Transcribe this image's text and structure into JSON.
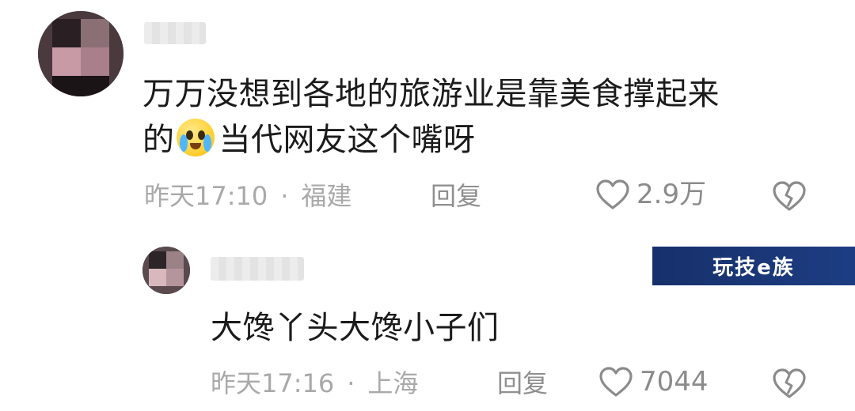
{
  "comments": [
    {
      "text_line1": "万万没想到各地的旅游业是靠美食撑起来",
      "text_line2_prefix": "的",
      "emoji": "crying-laughing-emoji",
      "text_line2_suffix": "当代网友这个嘴呀",
      "time": "昨天17:10",
      "location": "福建",
      "separator": "·",
      "reply_label": "回复",
      "likes": "2.9万"
    },
    {
      "text": "大馋丫头大馋小子们",
      "time": "昨天17:16",
      "location": "上海",
      "separator": "·",
      "reply_label": "回复",
      "likes": "7044"
    }
  ],
  "watermark": "玩技e族",
  "icons": {
    "like": "heart-outline-icon",
    "dislike": "broken-heart-icon"
  },
  "colors": {
    "text": "#1b1b1b",
    "meta": "#a9a9a9",
    "icon": "#8b8b8b",
    "watermark_bg": "#1d3d82"
  }
}
